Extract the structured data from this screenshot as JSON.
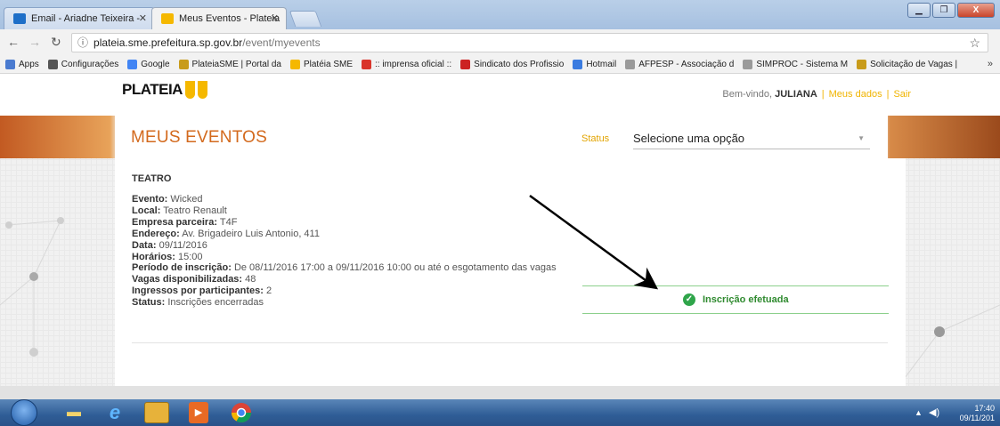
{
  "browser": {
    "tabs": [
      {
        "label": "Email - Ariadne Teixeira -",
        "icon": "outlook-icon",
        "active": false
      },
      {
        "label": "Meus Eventos - Plateia",
        "icon": "plateia-icon",
        "active": true
      }
    ],
    "close_glyph": "✕",
    "window_buttons": [
      "▁",
      "❐",
      "X"
    ],
    "url_host": "plateia.sme.prefeitura.sp.gov.br",
    "url_path": "/event/myevents",
    "bookmarks": [
      {
        "label": "Apps",
        "icon": "apps-icon",
        "color": "#4a7bd0"
      },
      {
        "label": "Configurações",
        "icon": "gear-icon",
        "color": "#555555"
      },
      {
        "label": "Google",
        "icon": "google-icon",
        "color": "#4285f4"
      },
      {
        "label": "PlateiaSME | Portal da",
        "icon": "sme-icon",
        "color": "#c89b1a"
      },
      {
        "label": "Platéia SME",
        "icon": "plateia-icon",
        "color": "#f5b800"
      },
      {
        "label": ":: imprensa oficial ::",
        "icon": "io-icon",
        "color": "#d9352b"
      },
      {
        "label": "Sindicato dos Profissio",
        "icon": "sindicato-icon",
        "color": "#cc2222"
      },
      {
        "label": "Hotmail",
        "icon": "hotmail-icon",
        "color": "#3a7be0"
      },
      {
        "label": "AFPESP - Associação d",
        "icon": "page-icon",
        "color": "#9a9a9a"
      },
      {
        "label": "SIMPROC - Sistema M",
        "icon": "page-icon",
        "color": "#9a9a9a"
      },
      {
        "label": "Solicitação de Vagas |",
        "icon": "sme-icon",
        "color": "#c89b1a"
      }
    ],
    "more": "»"
  },
  "site": {
    "logo": "PLATEIA",
    "welcome_prefix": "Bem-vindo,",
    "user": "JULIANA",
    "my_data": "Meus dados",
    "logout": "Sair",
    "separator": "|",
    "page_title": "MEUS EVENTOS",
    "status_label": "Status",
    "status_placeholder": "Selecione uma opção",
    "accent": "#d36a1e",
    "gold": "#f0b400"
  },
  "event": {
    "category": "TEATRO",
    "fields": [
      {
        "label": "Evento:",
        "value": "Wicked"
      },
      {
        "label": "Local:",
        "value": "Teatro Renault"
      },
      {
        "label": "Empresa parceira:",
        "value": "T4F"
      },
      {
        "label": "Endereço:",
        "value": "Av. Brigadeiro Luis Antonio, 411"
      },
      {
        "label": "Data:",
        "value": "09/11/2016"
      },
      {
        "label": "Horários:",
        "value": "15:00"
      },
      {
        "label": "Período de inscrição:",
        "value": "De 08/11/2016 17:00 a 09/11/2016 10:00 ou até o esgotamento das vagas"
      },
      {
        "label": "Vagas disponibilizadas:",
        "value": "48"
      },
      {
        "label": "Ingressos por participantes:",
        "value": "2"
      },
      {
        "label": "Status:",
        "value": "Inscrições encerradas"
      }
    ],
    "result": "Inscrição efetuada",
    "result_color": "#2f8a2f"
  },
  "taskbar": {
    "apps": [
      "explorer-icon",
      "ie-icon",
      "outlook-icon",
      "media-icon",
      "chrome-icon"
    ],
    "time": "17:40",
    "date": "09/11/201"
  }
}
